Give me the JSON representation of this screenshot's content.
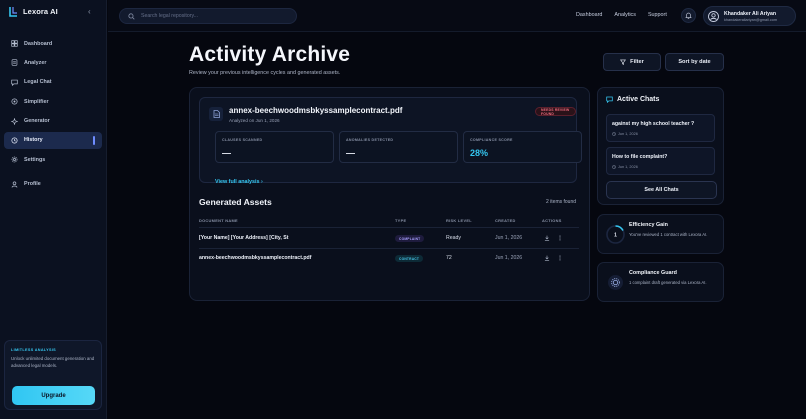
{
  "app": {
    "name": "Lexora AI"
  },
  "sidebar": {
    "items": [
      {
        "label": "Dashboard",
        "icon": "dashboard-icon"
      },
      {
        "label": "Analyzer",
        "icon": "analyzer-icon"
      },
      {
        "label": "Legal Chat",
        "icon": "chat-icon"
      },
      {
        "label": "Simplifier",
        "icon": "simplifier-icon"
      },
      {
        "label": "Generator",
        "icon": "generator-icon"
      },
      {
        "label": "History",
        "icon": "history-icon",
        "active": true
      },
      {
        "label": "Settings",
        "icon": "settings-icon"
      },
      {
        "label": "Profile",
        "icon": "profile-icon"
      }
    ],
    "promo": {
      "title": "LIMITLESS ANALYSIS",
      "text": "Unlock unlimited document generation and advanced legal models.",
      "button": "Upgrade"
    }
  },
  "topbar": {
    "search_placeholder": "Search legal repository...",
    "links": [
      "Dashboard",
      "Analytics",
      "Support"
    ],
    "user": {
      "name": "Khandaker Ali Ariyan",
      "email": "khandakeraliariyan@gmail.com"
    }
  },
  "page": {
    "title": "Activity Archive",
    "subtitle": "Review your previous intelligence cycles and generated assets.",
    "filter_label": "Filter",
    "sort_label": "Sort by date"
  },
  "analysis": {
    "file_name": "annex-beechwoodmsbkyssamplecontract.pdf",
    "date": "Analyzed on Jun 1, 2026",
    "badge": "NEEDS REVIEW FOUND",
    "stats": [
      {
        "label": "CLAUSES SCANNED",
        "value": "—"
      },
      {
        "label": "ANOMALIES DETECTED",
        "value": "—"
      },
      {
        "label": "COMPLIANCE SCORE",
        "value": "28%"
      }
    ],
    "view_link": "View full analysis"
  },
  "assets": {
    "title": "Generated Assets",
    "count": "2 items found",
    "columns": [
      "DOCUMENT NAME",
      "TYPE",
      "RISK LEVEL",
      "CREATED",
      "ACTIONS"
    ],
    "rows": [
      {
        "name": "[Your Name] [Your Address] [City, St",
        "type": "COMPLAINT",
        "risk": "Ready",
        "created": "Jun 1, 2026"
      },
      {
        "name": "annex-beechwoodmsbkyssamplecontract.pdf",
        "type": "CONTRACT",
        "risk": "72",
        "created": "Jun 1, 2026"
      }
    ]
  },
  "chats": {
    "title": "Active Chats",
    "items": [
      {
        "question": "against my high school teacher ?",
        "date": "Jun 1, 2026"
      },
      {
        "question": "How to file complaint?",
        "date": "Jun 1, 2026"
      }
    ],
    "see_all": "See All Chats"
  },
  "insights": {
    "efficiency": {
      "title": "Efficiency Gain",
      "text": "You've reviewed 1 contract with Lexora AI.",
      "count": "1"
    },
    "compliance": {
      "title": "Compliance Guard",
      "text": "1 complaint draft generated via Lexora AI."
    }
  },
  "colors": {
    "accent": "#35c6f0",
    "active_nav": "#1c2a4d",
    "danger": "#f06b7e"
  }
}
